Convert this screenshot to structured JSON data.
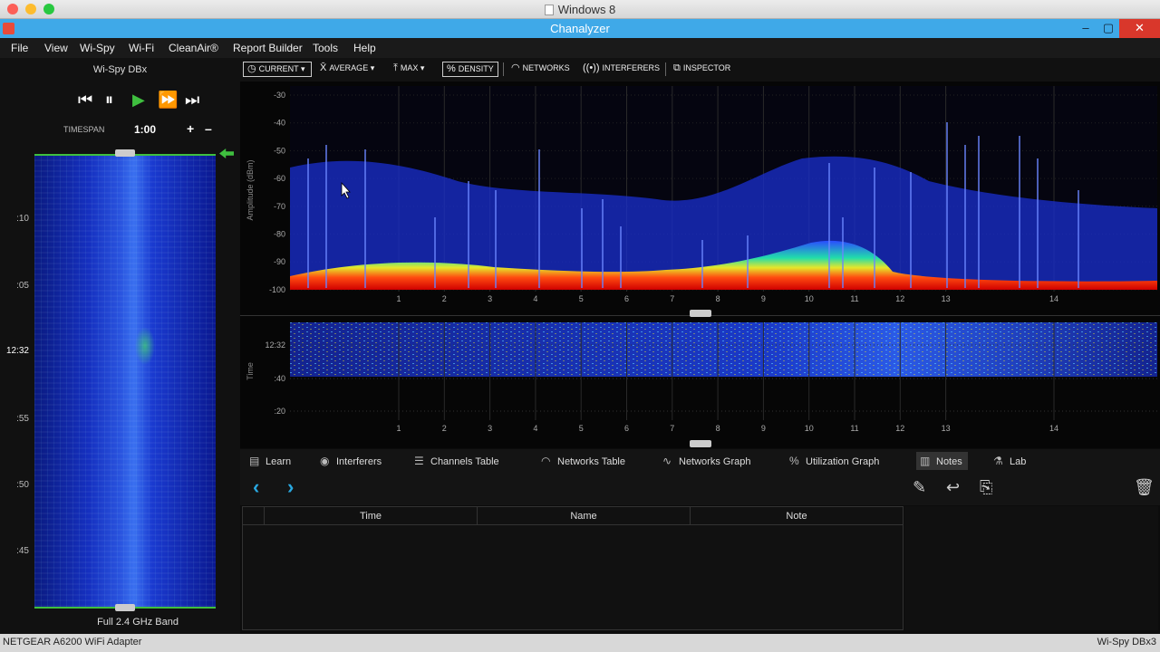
{
  "host_window": {
    "title": "Windows 8"
  },
  "app_window": {
    "title": "Chanalyzer",
    "minimize": "–",
    "restore": "▢",
    "close": "✕"
  },
  "menu": {
    "items": [
      "File",
      "View",
      "Wi-Spy",
      "Wi-Fi",
      "CleanAir®",
      "Report Builder",
      "Tools",
      "Help"
    ]
  },
  "left_panel": {
    "device": "Wi-Spy DBx",
    "transport": {
      "skip_back": "⏮",
      "pause": "⏸",
      "play": "▶",
      "fast_forward": "⏩",
      "skip_end": "⏭"
    },
    "timespan_label": "TIMESPAN",
    "timespan_value": "1:00",
    "plus": "+",
    "minus": "–",
    "time_labels": [
      ":10",
      ":05",
      "12:32",
      ":55",
      ":50",
      ":45"
    ],
    "band": "Full 2.4 GHz Band"
  },
  "toolbar": {
    "current": "CURRENT",
    "average": "AVERAGE",
    "max": "MAX",
    "density": "DENSITY",
    "networks": "NETWORKS",
    "interferers": "INTERFERERS",
    "inspector": "INSPECTOR"
  },
  "spectrum": {
    "y_axis_title": "Amplitude (dBm)",
    "y_ticks": [
      "-30",
      "-40",
      "-50",
      "-60",
      "-70",
      "-80",
      "-90",
      "-100"
    ],
    "channels": [
      "1",
      "2",
      "3",
      "4",
      "5",
      "6",
      "7",
      "8",
      "9",
      "10",
      "11",
      "12",
      "13",
      "14"
    ]
  },
  "waterfall_chart": {
    "y_axis_title": "Time",
    "y_ticks": [
      "12:32",
      ":40",
      ":20"
    ],
    "channels": [
      "1",
      "2",
      "3",
      "4",
      "5",
      "6",
      "7",
      "8",
      "9",
      "10",
      "11",
      "12",
      "13",
      "14"
    ]
  },
  "tabs": [
    {
      "label": "Learn",
      "icon": "book-icon"
    },
    {
      "label": "Interferers",
      "icon": "interferer-icon"
    },
    {
      "label": "Channels Table",
      "icon": "table-icon"
    },
    {
      "label": "Networks Table",
      "icon": "wifi-icon"
    },
    {
      "label": "Networks Graph",
      "icon": "graph-icon"
    },
    {
      "label": "Utilization Graph",
      "icon": "percent-icon"
    },
    {
      "label": "Notes",
      "icon": "notes-icon",
      "active": true
    },
    {
      "label": "Lab",
      "icon": "lab-icon"
    }
  ],
  "notes": {
    "columns": [
      "Time",
      "Name",
      "Note"
    ],
    "prev": "‹",
    "next": "›"
  },
  "status": {
    "left": "NETGEAR A6200 WiFi Adapter",
    "right": "Wi-Spy DBx3"
  },
  "colors": {
    "accent": "#3fa9e8",
    "close": "#d9372b",
    "green": "#3fbf3f",
    "arrow": "#29a8e0"
  }
}
